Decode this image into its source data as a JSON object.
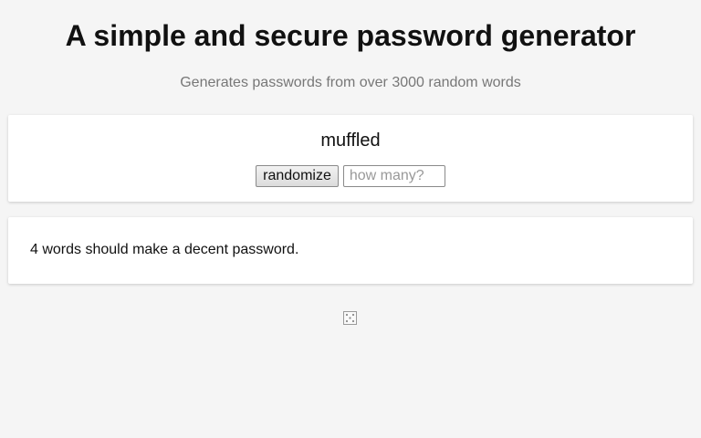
{
  "header": {
    "title": "A simple and secure password generator",
    "subtitle": "Generates passwords from over 3000 random words"
  },
  "generator": {
    "word": "muffled",
    "randomize_label": "randomize",
    "count_input": {
      "value": "",
      "placeholder": "how many?"
    }
  },
  "tip": {
    "text": "4 words should make a decent password."
  },
  "footer": {
    "icon": "dice-icon"
  },
  "colors": {
    "background": "#f5f5f5",
    "card": "#ffffff",
    "subtitle": "#777777",
    "text": "#111111"
  }
}
